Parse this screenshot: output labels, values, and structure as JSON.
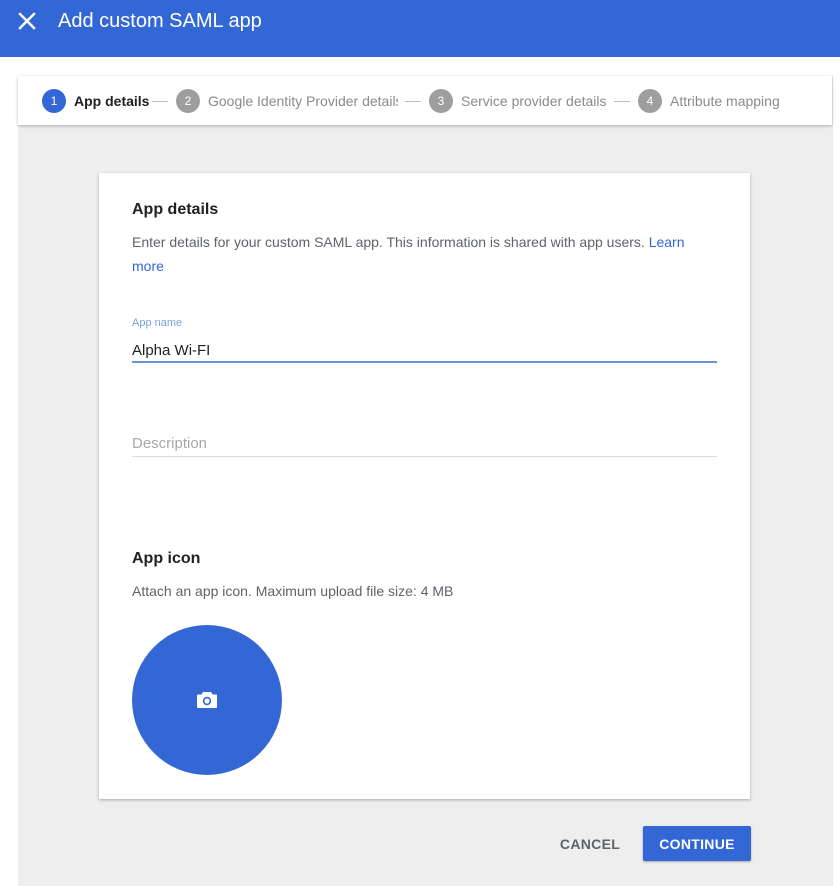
{
  "header": {
    "title": "Add custom SAML app",
    "close_icon": "close-icon"
  },
  "stepper": {
    "steps": [
      {
        "number": "1",
        "label": "App details",
        "active": true
      },
      {
        "number": "2",
        "label": "Google Identity Provider details",
        "active": false
      },
      {
        "number": "3",
        "label": "Service provider details",
        "active": false
      },
      {
        "number": "4",
        "label": "Attribute mapping",
        "active": false
      }
    ]
  },
  "app_details": {
    "title": "App details",
    "description": "Enter details for your custom SAML app. This information is shared with app users.",
    "learn_more": "Learn more",
    "app_name_label": "App name",
    "app_name_value": "Alpha Wi-FI",
    "description_placeholder": "Description"
  },
  "app_icon": {
    "title": "App icon",
    "description": "Attach an app icon. Maximum upload file size: 4 MB",
    "upload_icon": "camera-icon"
  },
  "footer": {
    "cancel_label": "CANCEL",
    "continue_label": "CONTINUE"
  },
  "colors": {
    "primary": "#3367d6",
    "background": "#eeeeee",
    "step_inactive": "#9e9e9e"
  }
}
